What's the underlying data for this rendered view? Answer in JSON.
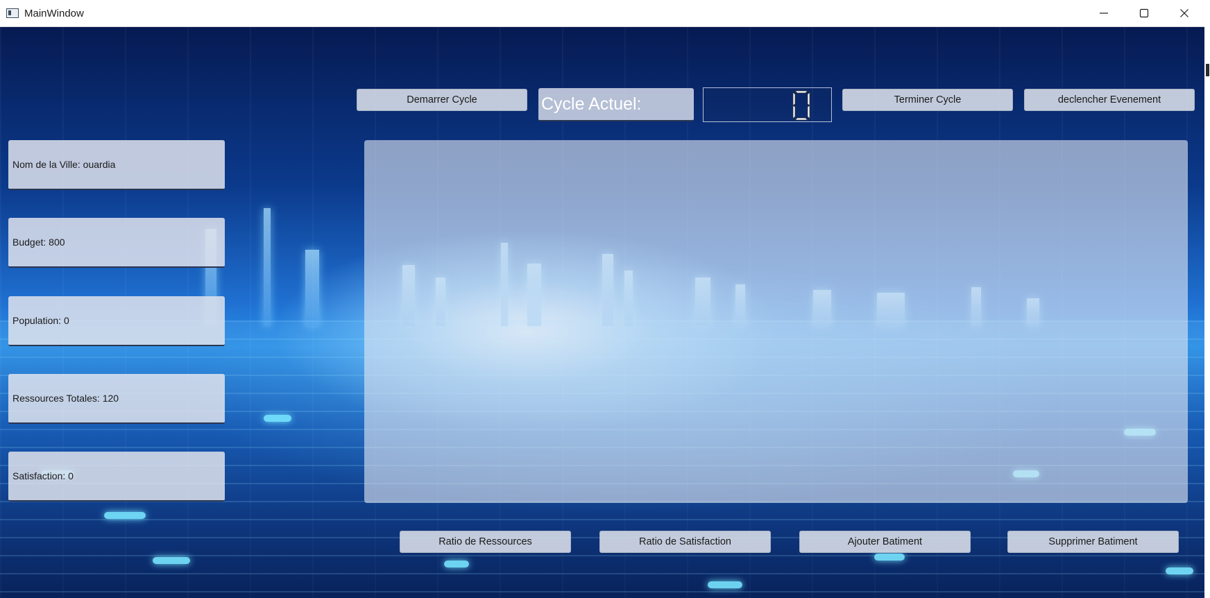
{
  "window": {
    "title": "MainWindow"
  },
  "toolbar": {
    "start_cycle": "Demarrer Cycle",
    "current_cycle_label": "Cycle Actuel:",
    "current_cycle_value": "0",
    "end_cycle": "Terminer Cycle",
    "trigger_event": "declencher Evenement"
  },
  "city_info": {
    "name": "Nom de la Ville: ouardia",
    "budget": "Budget: 800",
    "population": "Population: 0",
    "resources": "Ressources Totales: 120",
    "satisfaction": "Satisfaction: 0"
  },
  "actions": {
    "resource_ratio": "Ratio de Ressources",
    "satisfaction_ratio": "Ratio de Satisfaction",
    "add_building": "Ajouter Batiment",
    "remove_building": "Supprimer Batiment"
  }
}
